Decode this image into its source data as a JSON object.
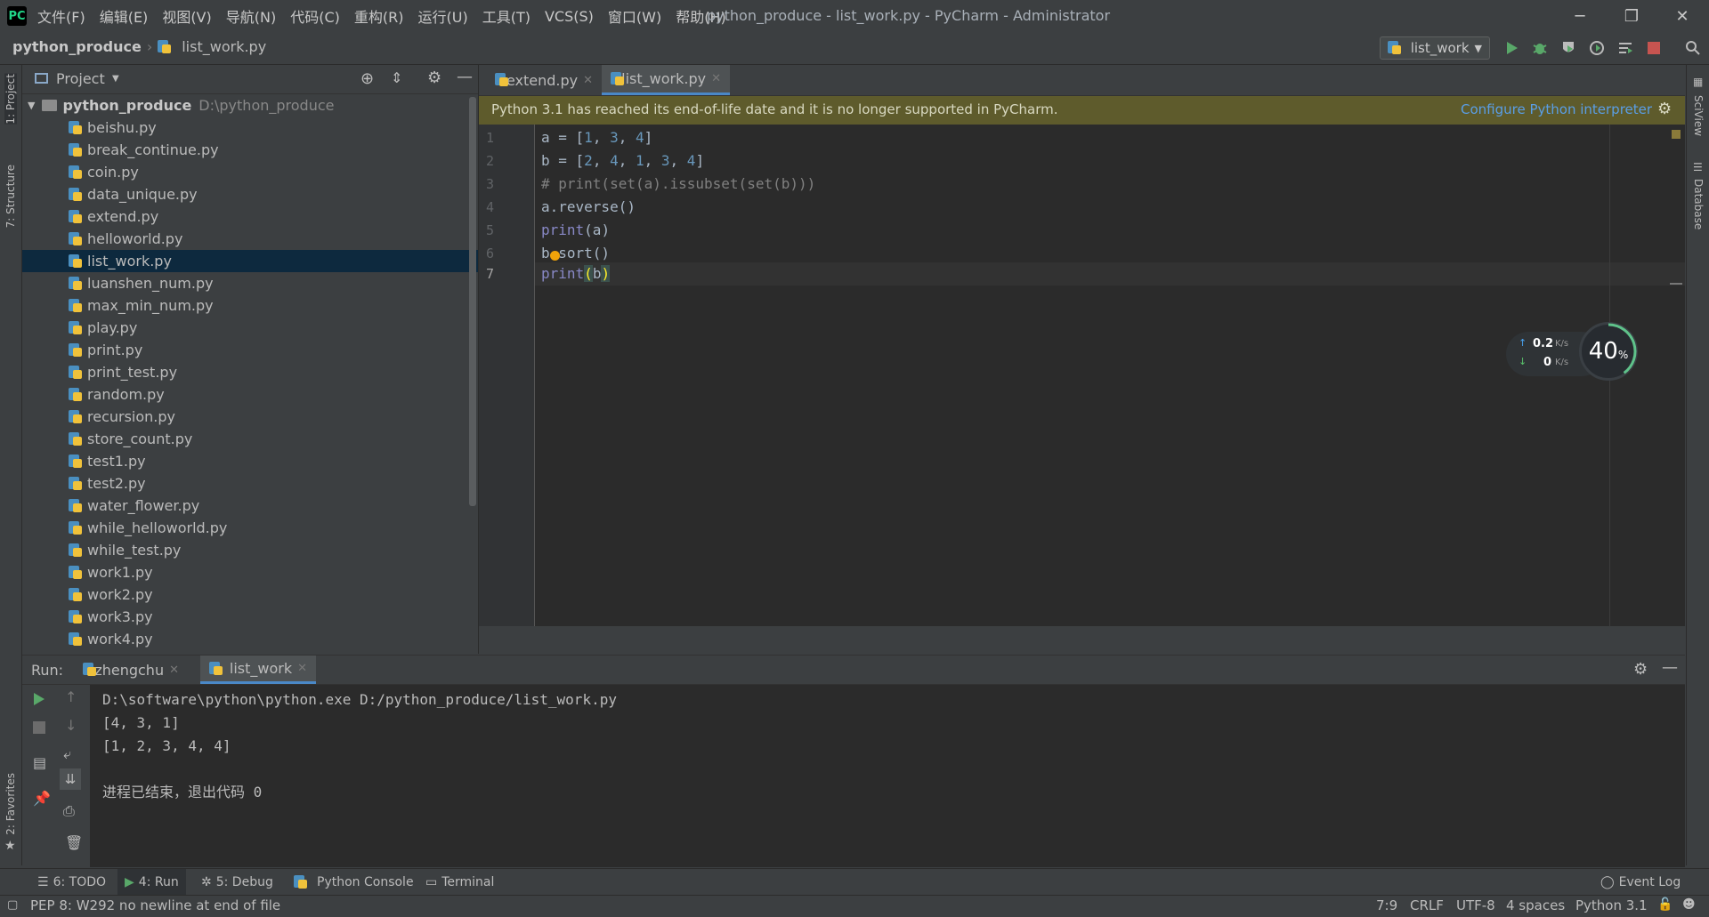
{
  "window": {
    "title": "python_produce - list_work.py - PyCharm - Administrator",
    "logo": "PC",
    "minimize_icon": "─",
    "restore_icon": "❐",
    "close_icon": "✕"
  },
  "menu": [
    "文件(F)",
    "编辑(E)",
    "视图(V)",
    "导航(N)",
    "代码(C)",
    "重构(R)",
    "运行(U)",
    "工具(T)",
    "VCS(S)",
    "窗口(W)",
    "帮助(H)"
  ],
  "breadcrumb": {
    "project": "python_produce",
    "file": "list_work.py"
  },
  "toolbar": {
    "run_config": "list_work",
    "icons": [
      "run-icon",
      "debug-icon",
      "coverage-icon",
      "profile-icon",
      "build-icon",
      "stop-icon",
      "search-icon"
    ]
  },
  "left_stripe": {
    "project_label": "1: Project",
    "structure_label": "7: Structure",
    "favorites_label": "2: Favorites"
  },
  "right_stripe": {
    "sciview_label": "SciView",
    "database_label": "Database"
  },
  "project": {
    "title": "Project",
    "root_name": "python_produce",
    "root_path": "D:\\python_produce",
    "files": [
      "beishu.py",
      "break_continue.py",
      "coin.py",
      "data_unique.py",
      "extend.py",
      "helloworld.py",
      "list_work.py",
      "luanshen_num.py",
      "max_min_num.py",
      "play.py",
      "print.py",
      "print_test.py",
      "random.py",
      "recursion.py",
      "store_count.py",
      "test1.py",
      "test2.py",
      "water_flower.py",
      "while_helloworld.py",
      "while_test.py",
      "work1.py",
      "work2.py",
      "work3.py",
      "work4.py"
    ],
    "selected": "list_work.py"
  },
  "editor": {
    "tabs": [
      {
        "label": "extend.py",
        "active": false
      },
      {
        "label": "list_work.py",
        "active": true
      }
    ],
    "banner": {
      "message": "Python 3.1 has reached its end-of-life date and it is no longer supported in PyCharm.",
      "action": "Configure Python interpreter"
    },
    "line_numbers": [
      "1",
      "2",
      "3",
      "4",
      "5",
      "6",
      "7"
    ]
  },
  "network": {
    "upload": "0.2",
    "upload_unit": "K/s",
    "download": "0",
    "download_unit": "K/s",
    "percent": "40",
    "percent_sign": "%"
  },
  "run": {
    "label": "Run:",
    "tabs": [
      {
        "label": "zhengchu",
        "active": false
      },
      {
        "label": "list_work",
        "active": true
      }
    ],
    "output": [
      "D:\\software\\python\\python.exe D:/python_produce/list_work.py",
      "[4, 3, 1]",
      "[1, 2, 3, 4, 4]",
      "",
      "进程已结束，退出代码 0"
    ]
  },
  "bottom_tools": [
    {
      "label": "6: TODO",
      "icon": "list-icon"
    },
    {
      "label": "4: Run",
      "icon": "run-icon",
      "active": true
    },
    {
      "label": "5: Debug",
      "icon": "debug-icon"
    },
    {
      "label": "Python Console",
      "icon": "python-icon"
    },
    {
      "label": "Terminal",
      "icon": "terminal-icon"
    }
  ],
  "event_log": "Event Log",
  "status": {
    "message": "PEP 8: W292 no newline at end of file",
    "position": "7:9",
    "line_sep": "CRLF",
    "encoding": "UTF-8",
    "indent": "4 spaces",
    "interpreter": "Python 3.1"
  },
  "colors": {
    "accent": "#4a88c7",
    "banner": "#5e5b2c",
    "keyword_blue": "#6897bb",
    "comment": "#808080",
    "builtin": "#8888c6"
  }
}
